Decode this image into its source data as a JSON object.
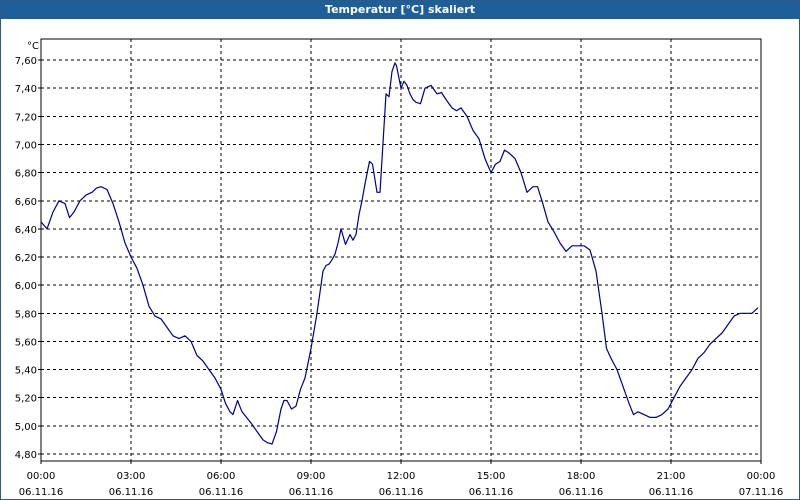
{
  "window": {
    "title": "Temperatur [°C] skaliert"
  },
  "colors": {
    "titlebar": "#1f5f99",
    "line": "#00008b",
    "grid": "#000000",
    "background": "#ffffff"
  },
  "chart_data": {
    "type": "line",
    "title": "Temperatur [°C] skaliert",
    "ylabel": "°C",
    "xlabel": "",
    "ylim": [
      4.75,
      7.75
    ],
    "xlim_hours": [
      0,
      24
    ],
    "grid": true,
    "y_ticks": [
      "4,80",
      "5,00",
      "5,20",
      "5,40",
      "5,60",
      "5,80",
      "6,00",
      "6,20",
      "6,40",
      "6,60",
      "6,80",
      "7,00",
      "7,20",
      "7,40",
      "7,60"
    ],
    "y_tick_values": [
      4.8,
      5.0,
      5.2,
      5.4,
      5.6,
      5.8,
      6.0,
      6.2,
      6.4,
      6.6,
      6.8,
      7.0,
      7.2,
      7.4,
      7.6
    ],
    "x_ticks": [
      {
        "time": "00:00",
        "date": "06.11.16",
        "hour": 0
      },
      {
        "time": "03:00",
        "date": "06.11.16",
        "hour": 3
      },
      {
        "time": "06:00",
        "date": "06.11.16",
        "hour": 6
      },
      {
        "time": "09:00",
        "date": "06.11.16",
        "hour": 9
      },
      {
        "time": "12:00",
        "date": "06.11.16",
        "hour": 12
      },
      {
        "time": "15:00",
        "date": "06.11.16",
        "hour": 15
      },
      {
        "time": "18:00",
        "date": "06.11.16",
        "hour": 18
      },
      {
        "time": "21:00",
        "date": "06.11.16",
        "hour": 21
      },
      {
        "time": "00:00",
        "date": "07.11.16",
        "hour": 24
      }
    ],
    "series": [
      {
        "x": [
          0.0,
          0.2,
          0.4,
          0.6,
          0.8,
          0.95,
          1.1,
          1.3,
          1.5,
          1.7,
          1.85,
          2.0,
          2.2,
          2.4,
          2.6,
          2.8,
          3.0,
          3.2,
          3.4,
          3.6,
          3.8,
          4.0,
          4.2,
          4.4,
          4.6,
          4.8,
          5.0,
          5.2,
          5.4,
          5.6,
          5.8,
          6.0,
          6.15,
          6.3,
          6.4,
          6.55,
          6.7,
          6.85,
          7.0,
          7.2,
          7.4,
          7.55,
          7.7,
          7.85,
          8.0,
          8.1,
          8.2,
          8.35,
          8.5,
          8.65,
          8.8,
          9.0,
          9.2,
          9.4,
          9.5,
          9.6,
          9.7,
          9.8,
          9.9,
          10.0,
          10.15,
          10.3,
          10.4,
          10.5,
          10.6,
          10.7,
          10.8,
          10.95,
          11.05,
          11.2,
          11.3,
          11.5,
          11.6,
          11.7,
          11.8,
          11.85,
          12.0,
          12.1,
          12.2,
          12.3,
          12.4,
          12.5,
          12.65,
          12.8,
          13.0,
          13.2,
          13.35,
          13.5,
          13.7,
          13.85,
          14.0,
          14.2,
          14.4,
          14.6,
          14.8,
          15.0,
          15.15,
          15.3,
          15.45,
          15.6,
          15.8,
          16.0,
          16.2,
          16.4,
          16.55,
          16.7,
          16.9,
          17.1,
          17.3,
          17.5,
          17.7,
          17.9,
          18.1,
          18.3,
          18.5,
          18.7,
          18.85,
          19.0,
          19.2,
          19.4,
          19.6,
          19.75,
          19.9,
          20.1,
          20.3,
          20.5,
          20.7,
          20.9,
          21.1,
          21.3,
          21.5,
          21.7,
          21.9,
          22.1,
          22.3,
          22.5,
          22.7,
          22.9,
          23.1,
          23.3,
          23.5,
          23.7,
          23.9
        ],
        "y": [
          6.45,
          6.4,
          6.52,
          6.6,
          6.58,
          6.48,
          6.52,
          6.6,
          6.64,
          6.66,
          6.69,
          6.7,
          6.68,
          6.58,
          6.45,
          6.3,
          6.2,
          6.12,
          6.0,
          5.85,
          5.78,
          5.76,
          5.7,
          5.64,
          5.62,
          5.64,
          5.6,
          5.5,
          5.46,
          5.4,
          5.34,
          5.26,
          5.16,
          5.1,
          5.08,
          5.18,
          5.1,
          5.06,
          5.02,
          4.96,
          4.9,
          4.88,
          4.87,
          4.96,
          5.12,
          5.18,
          5.18,
          5.12,
          5.14,
          5.26,
          5.34,
          5.55,
          5.8,
          6.1,
          6.14,
          6.15,
          6.18,
          6.22,
          6.3,
          6.4,
          6.29,
          6.36,
          6.32,
          6.36,
          6.5,
          6.6,
          6.72,
          6.88,
          6.86,
          6.66,
          6.66,
          7.36,
          7.34,
          7.52,
          7.58,
          7.56,
          7.4,
          7.45,
          7.42,
          7.36,
          7.32,
          7.3,
          7.29,
          7.4,
          7.42,
          7.36,
          7.37,
          7.32,
          7.26,
          7.24,
          7.26,
          7.2,
          7.1,
          7.04,
          6.9,
          6.8,
          6.86,
          6.88,
          6.96,
          6.94,
          6.9,
          6.8,
          6.66,
          6.7,
          6.7,
          6.6,
          6.45,
          6.38,
          6.3,
          6.24,
          6.28,
          6.28,
          6.28,
          6.25,
          6.1,
          5.8,
          5.55,
          5.48,
          5.4,
          5.28,
          5.16,
          5.08,
          5.1,
          5.08,
          5.06,
          5.06,
          5.08,
          5.12,
          5.2,
          5.28,
          5.34,
          5.4,
          5.48,
          5.52,
          5.58,
          5.62,
          5.66,
          5.72,
          5.78,
          5.8,
          5.8,
          5.8,
          5.84
        ]
      }
    ]
  }
}
